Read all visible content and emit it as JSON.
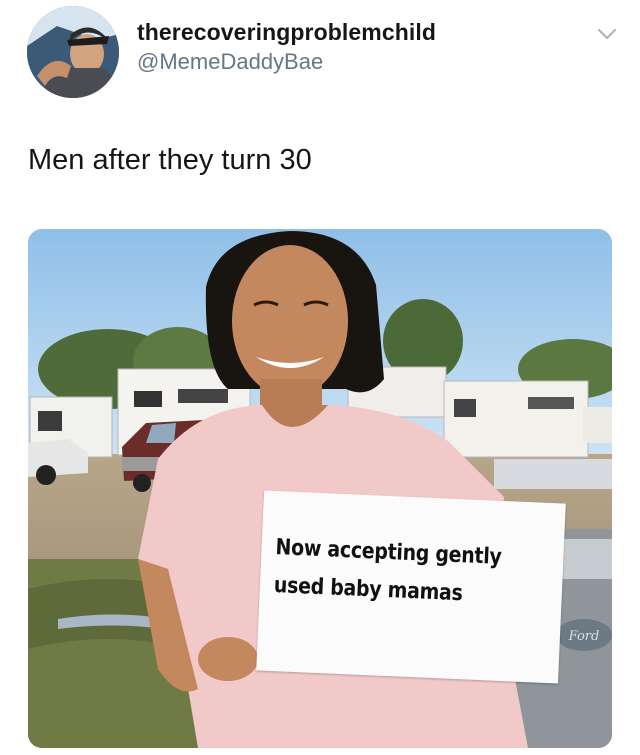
{
  "tweet": {
    "display_name": "therecoveringproblemchild",
    "handle": "@MemeDaddyBae",
    "text": "Men after they turn 30"
  },
  "meme": {
    "sign_line_1": "Now accepting gently",
    "sign_line_2": "used baby mamas",
    "truck_emblem": "Ford"
  },
  "colors": {
    "text_primary": "#14171a",
    "text_secondary": "#657786",
    "chevron": "#aab8c2"
  },
  "icons": {
    "menu": "chevron-down-icon"
  }
}
